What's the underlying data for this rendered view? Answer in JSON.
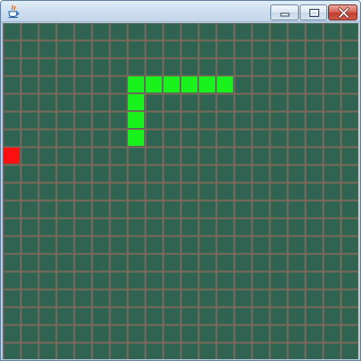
{
  "window": {
    "title": "",
    "controls": {
      "minimize_icon": "minimize-icon",
      "maximize_icon": "maximize-icon",
      "close_icon": "close-icon"
    }
  },
  "game": {
    "name": "snake",
    "grid": {
      "cols": 20,
      "rows": 19
    },
    "colors": {
      "background": "#2f6352",
      "grid_line": "#7b6a5a",
      "snake": "#19f21c",
      "food": "#ff1010"
    },
    "snake_cells": [
      [
        7,
        3
      ],
      [
        8,
        3
      ],
      [
        9,
        3
      ],
      [
        10,
        3
      ],
      [
        11,
        3
      ],
      [
        12,
        3
      ],
      [
        7,
        4
      ],
      [
        7,
        5
      ],
      [
        7,
        6
      ]
    ],
    "food_cell": [
      0,
      7
    ]
  }
}
